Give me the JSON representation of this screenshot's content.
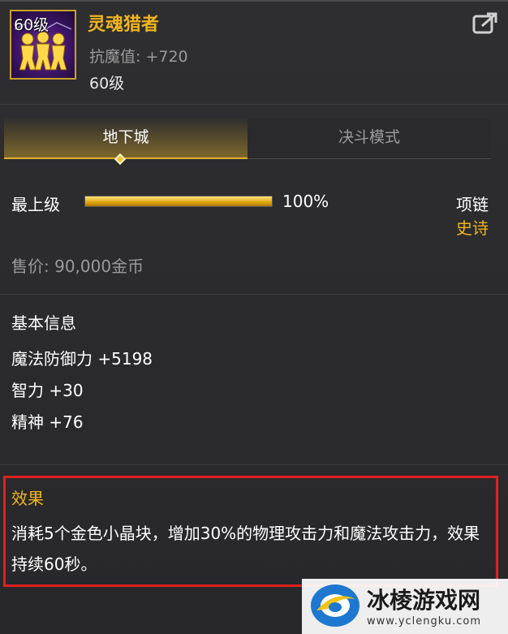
{
  "item": {
    "level_badge": "60级",
    "name": "灵魂猎者",
    "stat": "抗魔值: +720",
    "level": "60级"
  },
  "tabs": [
    {
      "label": "地下城",
      "active": true
    },
    {
      "label": "决斗模式",
      "active": false
    }
  ],
  "upgrade": {
    "label": "最上级",
    "progress": 100,
    "progress_text": "100%"
  },
  "type": "项链",
  "rarity": "史诗",
  "price": "售价: 90,000金币",
  "basic_info": {
    "title": "基本信息",
    "stats": [
      "魔法防御力 +5198",
      "智力 +30",
      "精神 +76"
    ]
  },
  "effect": {
    "title": "效果",
    "text": "消耗5个金色小晶块，增加30%的物理攻击力和魔法攻击力，效果持续60秒。"
  },
  "watermark": {
    "title": "冰棱游戏网",
    "url": "www.yclengku.com"
  },
  "colors": {
    "gold": "#f0b51e",
    "highlight_border": "#e02020",
    "background": "#2b2b2d"
  }
}
